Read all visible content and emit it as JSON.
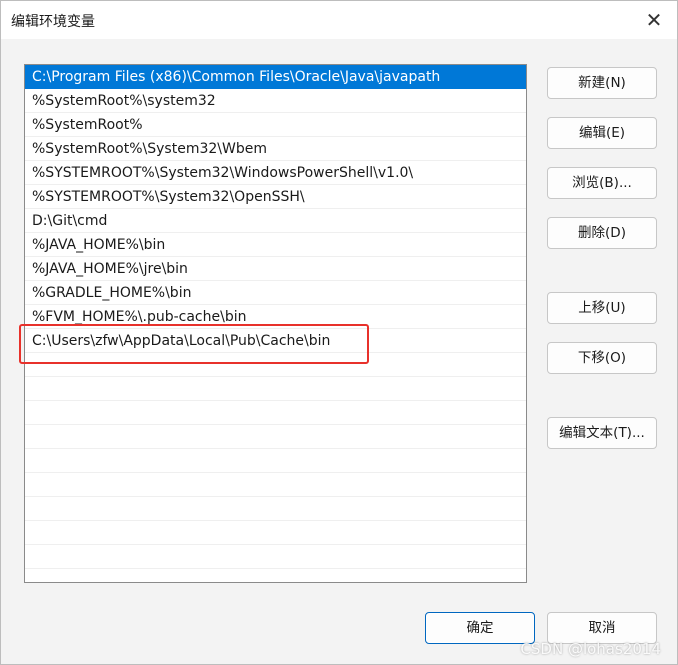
{
  "window": {
    "title": "编辑环境变量",
    "close_glyph": "✕"
  },
  "paths": [
    "C:\\Program Files (x86)\\Common Files\\Oracle\\Java\\javapath",
    "%SystemRoot%\\system32",
    "%SystemRoot%",
    "%SystemRoot%\\System32\\Wbem",
    "%SYSTEMROOT%\\System32\\WindowsPowerShell\\v1.0\\",
    "%SYSTEMROOT%\\System32\\OpenSSH\\",
    "D:\\Git\\cmd",
    "%JAVA_HOME%\\bin",
    "%JAVA_HOME%\\jre\\bin",
    "%GRADLE_HOME%\\bin",
    "%FVM_HOME%\\.pub-cache\\bin",
    "C:\\Users\\zfw\\AppData\\Local\\Pub\\Cache\\bin",
    "",
    "",
    "",
    "",
    "",
    "",
    "",
    "",
    "",
    ""
  ],
  "selected_index": 0,
  "buttons": {
    "new": "新建(N)",
    "edit": "编辑(E)",
    "browse": "浏览(B)...",
    "delete": "删除(D)",
    "move_up": "上移(U)",
    "move_down": "下移(O)",
    "edit_text": "编辑文本(T)...",
    "ok": "确定",
    "cancel": "取消"
  },
  "watermark": "CSDN @lohas2014",
  "colors": {
    "selection": "#0078d7",
    "annotation": "#e8312b"
  }
}
